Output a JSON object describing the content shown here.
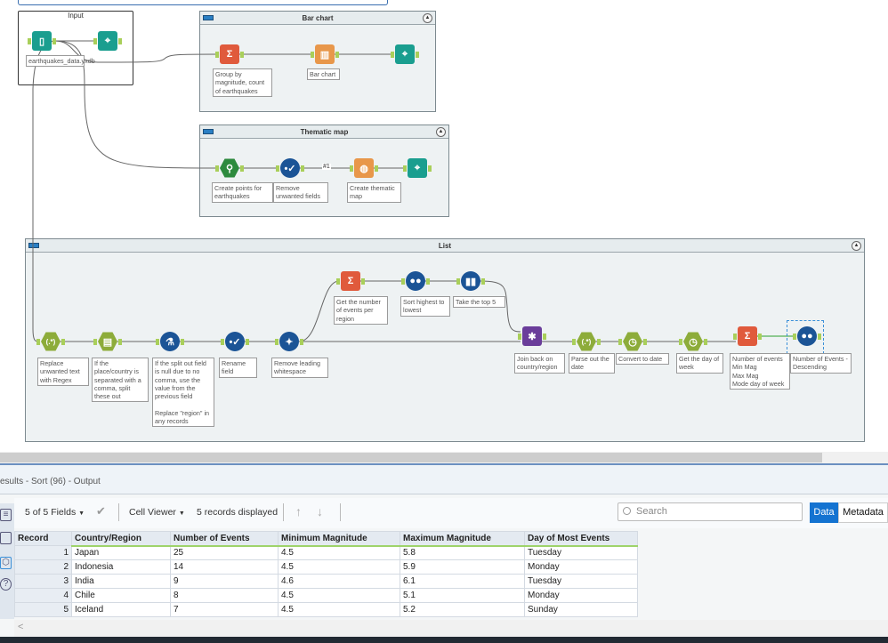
{
  "canvas": {
    "input_container": {
      "title": "Input"
    },
    "containers": [
      {
        "title": "Bar chart"
      },
      {
        "title": "Thematic map"
      },
      {
        "title": "List"
      }
    ],
    "connection_label": "#1",
    "tools": [
      {
        "icon": "input-data-icon",
        "label": "earthquakes_data.yxdb",
        "color": "#1a9e8f"
      },
      {
        "icon": "browse-binoculars-icon",
        "label": "",
        "color": "#1a9e8f"
      },
      {
        "icon": "summarize-sigma-icon",
        "label": "Group by magnitude, count of earthquakes",
        "color": "#e05a3c"
      },
      {
        "icon": "bar-chart-icon",
        "label": "Bar chart",
        "color": "#e8974a"
      },
      {
        "icon": "browse-binoculars-icon",
        "label": "",
        "color": "#1a9e8f"
      },
      {
        "icon": "create-points-icon",
        "label": "Create points for earthquakes",
        "color": "#2d8a3e"
      },
      {
        "icon": "select-icon",
        "label": "Remove unwanted fields",
        "color": "#1b5496"
      },
      {
        "icon": "thematic-map-icon",
        "label": "Create thematic map",
        "color": "#e8974a"
      },
      {
        "icon": "browse-binoculars-icon",
        "label": "",
        "color": "#1a9e8f"
      },
      {
        "icon": "regex-icon",
        "label": "Replace unwanted text with Regex",
        "color": "#8dac3a"
      },
      {
        "icon": "text-to-columns-icon",
        "label": "If the place/country is separated with a comma, split these out",
        "color": "#8dac3a"
      },
      {
        "icon": "formula-icon",
        "label": "If the split out field is null due to no comma, use the value from the previous field\n\nReplace \"region\" in any records",
        "color": "#1b5496"
      },
      {
        "icon": "select-icon",
        "label": "Rename field",
        "color": "#1b5496"
      },
      {
        "icon": "data-cleansing-icon",
        "label": "Remove leading whitespace",
        "color": "#1b5496"
      },
      {
        "icon": "summarize-sigma-icon",
        "label": "Get the number of events per region",
        "color": "#e05a3c"
      },
      {
        "icon": "sort-icon",
        "label": "Sort highest to lowest",
        "color": "#1b5496"
      },
      {
        "icon": "sample-icon",
        "label": "Take the top 5",
        "color": "#1b5496"
      },
      {
        "icon": "join-icon",
        "label": "Join back on country/region",
        "color": "#6a3d9a"
      },
      {
        "icon": "regex-icon",
        "label": "Parse out the date",
        "color": "#8dac3a"
      },
      {
        "icon": "datetime-icon",
        "label": "Convert to date",
        "color": "#8dac3a"
      },
      {
        "icon": "datetime-icon",
        "label": "Get the day of week",
        "color": "#8dac3a"
      },
      {
        "icon": "summarize-sigma-icon",
        "label": "Number of events\nMin Mag\nMax Mag\nMode day of week",
        "color": "#e05a3c"
      },
      {
        "icon": "sort-icon",
        "label": "Number of Events - Descending",
        "color": "#1b5496"
      }
    ]
  },
  "results": {
    "title": "esults - Sort (96) - Output",
    "fields": "5 of 5 Fields",
    "viewer": "Cell Viewer",
    "records_displayed": "5 records displayed",
    "search_placeholder": "Search",
    "tab_data": "Data",
    "tab_metadata": "Metadata",
    "columns": [
      "Record",
      "Country/Region",
      "Number of Events",
      "Minimum Magnitude",
      "Maximum Magnitude",
      "Day of Most Events"
    ],
    "rows": [
      [
        "1",
        "Japan",
        "25",
        "4.5",
        "5.8",
        "Tuesday"
      ],
      [
        "2",
        "Indonesia",
        "14",
        "4.5",
        "5.9",
        "Monday"
      ],
      [
        "3",
        "India",
        "9",
        "4.6",
        "6.1",
        "Tuesday"
      ],
      [
        "4",
        "Chile",
        "8",
        "4.5",
        "5.1",
        "Monday"
      ],
      [
        "5",
        "Iceland",
        "7",
        "4.5",
        "5.2",
        "Sunday"
      ]
    ],
    "scroll_left": "<"
  },
  "colors": {
    "accent": "#1473d1",
    "anchor": "#a9cf5a",
    "selected_wire": "#2ca02c"
  }
}
